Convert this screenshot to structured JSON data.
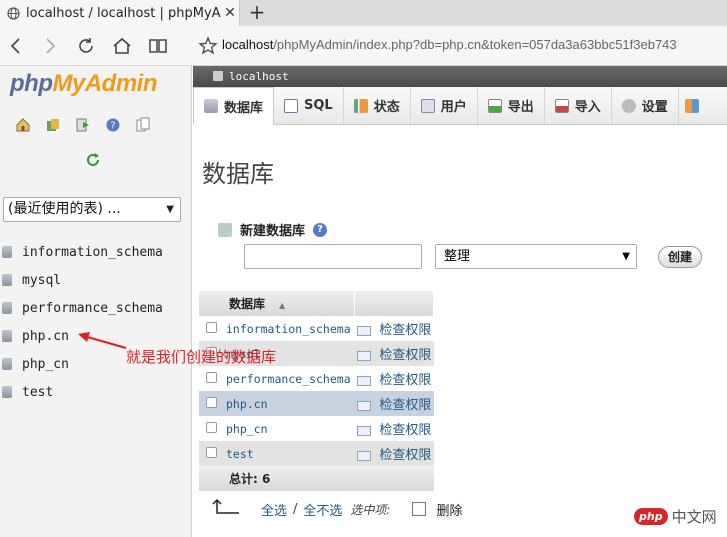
{
  "browser": {
    "tab_title": "localhost / localhost | phpMyAdmin",
    "tab_close": "✕",
    "new_tab": "+",
    "url_host": "localhost",
    "url_rest": "/phpMyAdmin/index.php?db=php.cn&token=057da3a63bbc51f3eb743"
  },
  "sidebar": {
    "logo_php": "php",
    "logo_myadmin": "MyAdmin",
    "recent_select": "(最近使用的表) ...",
    "databases": [
      "information_schema",
      "mysql",
      "performance_schema",
      "php.cn",
      "php_cn",
      "test"
    ]
  },
  "annotation": {
    "text": "就是我们创建的数据库",
    "color": "#e02020"
  },
  "main": {
    "server_label": "localhost",
    "tabs": [
      {
        "label": "数据库",
        "icon": "database-icon",
        "active": true
      },
      {
        "label": "SQL",
        "icon": "sql-icon"
      },
      {
        "label": "状态",
        "icon": "status-icon"
      },
      {
        "label": "用户",
        "icon": "users-icon"
      },
      {
        "label": "导出",
        "icon": "export-icon"
      },
      {
        "label": "导入",
        "icon": "import-icon"
      },
      {
        "label": "设置",
        "icon": "settings-icon"
      }
    ],
    "page_title": "数据库",
    "new_db_label": "新建数据库",
    "collation_value": "整理",
    "create_button": "创建",
    "table": {
      "header_name": "数据库",
      "rows": [
        {
          "name": "information_schema",
          "priv": "检查权限"
        },
        {
          "name": "mysql",
          "priv": "检查权限"
        },
        {
          "name": "performance_schema",
          "priv": "检查权限"
        },
        {
          "name": "php.cn",
          "priv": "检查权限"
        },
        {
          "name": "php_cn",
          "priv": "检查权限"
        },
        {
          "name": "test",
          "priv": "检查权限"
        }
      ],
      "total_label": "总计: 6"
    },
    "bottom": {
      "select_all": "全选",
      "separator": "/",
      "deselect_all": "全不选",
      "with_selected": "选中项:",
      "delete": "删除"
    }
  },
  "watermark": {
    "badge": "php",
    "text": "中文网"
  },
  "colors": {
    "link": "#235a81",
    "highlight_row": "#c7d2e0",
    "logo_php": "#5b6c9d",
    "logo_orange": "#f29a1a"
  }
}
